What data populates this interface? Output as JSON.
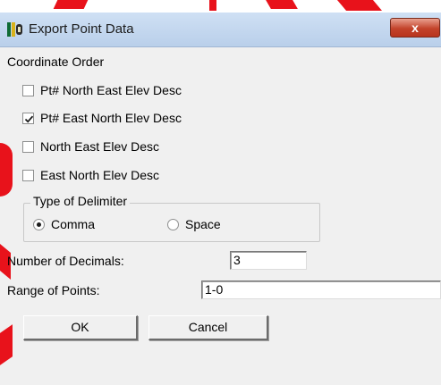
{
  "window": {
    "title": "Export Point Data",
    "close_label": "x",
    "app_icon": "pillars-app-icon"
  },
  "coordinate_order": {
    "label": "Coordinate Order",
    "options": [
      {
        "label": "Pt# North East Elev Desc",
        "checked": false
      },
      {
        "label": "Pt# East North Elev Desc",
        "checked": true
      },
      {
        "label": "North East Elev Desc",
        "checked": false
      },
      {
        "label": "East North Elev Desc",
        "checked": false
      }
    ]
  },
  "delimiter": {
    "label": "Type of Delimiter",
    "options": [
      {
        "label": "Comma",
        "selected": true
      },
      {
        "label": "Space",
        "selected": false
      }
    ]
  },
  "decimals": {
    "label": "Number of Decimals:",
    "value": "3"
  },
  "range": {
    "label": "Range of Points:",
    "value": "1-0"
  },
  "buttons": {
    "ok": "OK",
    "cancel": "Cancel"
  },
  "colors": {
    "annotation": "#e8121b",
    "titlebar": "#c3d6ee",
    "close": "#c3432b",
    "panel": "#f0f0f0"
  }
}
